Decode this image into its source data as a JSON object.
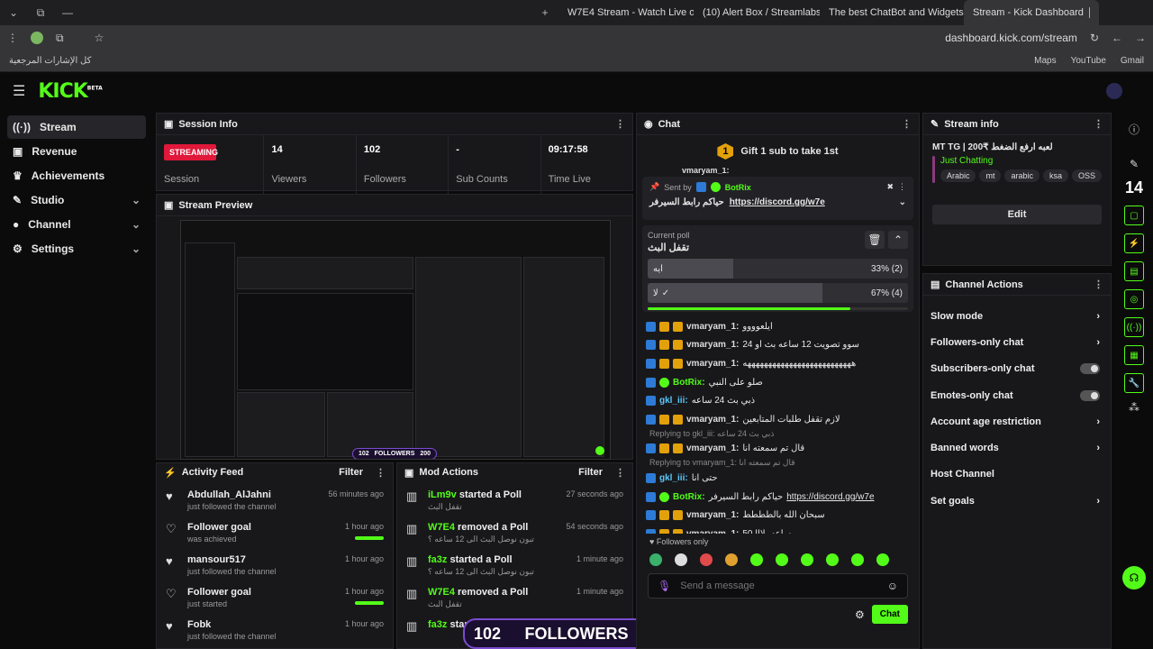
{
  "browser": {
    "tabs": [
      {
        "label": "W7E4 Stream - Watch Live on K"
      },
      {
        "label": "(10) Alert Box / Streamlabs"
      },
      {
        "label": "The best ChatBot and Widgets"
      },
      {
        "label": "Stream - Kick Dashboard"
      }
    ],
    "url": "dashboard.kick.com/stream",
    "bookmarks_folder": "كل الإشارات المرجعية",
    "bookmarks": [
      "Maps",
      "YouTube",
      "Gmail"
    ]
  },
  "brand": {
    "logo": "KICK",
    "beta": "BETA",
    "accent": "#53fc18"
  },
  "sidebar": {
    "items": [
      {
        "label": "Stream",
        "icon": "broadcast-icon"
      },
      {
        "label": "Revenue",
        "icon": "wallet-icon"
      },
      {
        "label": "Achievements",
        "icon": "trophy-icon"
      },
      {
        "label": "Studio",
        "icon": "pen-icon"
      },
      {
        "label": "Channel",
        "icon": "user-icon"
      },
      {
        "label": "Settings",
        "icon": "gear-icon"
      }
    ]
  },
  "session": {
    "title": "Session Info",
    "status": "STREAMING",
    "session_label": "Session",
    "stats": [
      {
        "value": "14",
        "label": "Viewers"
      },
      {
        "value": "102",
        "label": "Followers"
      },
      {
        "value": "-",
        "label": "Sub Counts"
      },
      {
        "value": "09:17:58",
        "label": "Time Live"
      }
    ]
  },
  "preview": {
    "title": "Stream Preview",
    "overlay_count": "102",
    "overlay_label": "FOLLOWERS",
    "overlay_goal": "200"
  },
  "activity": {
    "title": "Activity Feed",
    "filter": "Filter",
    "items": [
      {
        "icon": "heart-icon",
        "name": "Abdullah_AlJahni",
        "desc": "just followed the channel",
        "time": "56 minutes ago",
        "bar": false
      },
      {
        "icon": "heart-outline-icon",
        "name": "Follower goal",
        "desc": "was achieved",
        "time": "1 hour ago",
        "bar": true
      },
      {
        "icon": "heart-icon",
        "name": "mansour517",
        "desc": "just followed the channel",
        "time": "1 hour ago",
        "bar": false
      },
      {
        "icon": "heart-outline-icon",
        "name": "Follower goal",
        "desc": "just started",
        "time": "1 hour ago",
        "bar": true
      },
      {
        "icon": "heart-icon",
        "name": "Fobk",
        "desc": "just followed the channel",
        "time": "1 hour ago",
        "bar": false
      }
    ]
  },
  "mod": {
    "title": "Mod Actions",
    "filter": "Filter",
    "items": [
      {
        "user": "iLm9v",
        "action": "started a Poll",
        "detail": "تقفل البث",
        "time": "27 seconds ago"
      },
      {
        "user": "W7E4",
        "action": "removed a Poll",
        "detail": "تبون نوصل البث الى 12 ساعه ؟",
        "time": "54 seconds ago"
      },
      {
        "user": "fa3z",
        "action": "started a Poll",
        "detail": "تبون نوصل البث الى 12 ساعه ؟",
        "time": "1 minute ago"
      },
      {
        "user": "W7E4",
        "action": "removed a Poll",
        "detail": "تقفل البث",
        "time": "1 minute ago"
      },
      {
        "user": "fa3z",
        "action": "started a Poll",
        "detail": "",
        "time": ""
      }
    ]
  },
  "bottom_overlay": {
    "count": "102",
    "label": "FOLLOWERS",
    "goal": "200"
  },
  "chat": {
    "title": "Chat",
    "gift": "Gift 1 sub to take 1st",
    "gift_count": "1",
    "truncated_top": "vmaryam_1:",
    "pinned": {
      "sent_by": "Sent by",
      "user": "BotRix",
      "text": "حياكم رابط السيرفر",
      "link": "https://discord.gg/w7e"
    },
    "poll": {
      "label": "Current poll",
      "question": "تقفل البث",
      "options": [
        {
          "label": "ايه",
          "result": "33% (2)",
          "pct": 33,
          "voted": false
        },
        {
          "label": "لا",
          "result": "67% (4)",
          "pct": 67,
          "voted": true
        }
      ],
      "timer_fraction": 0.78
    },
    "messages": [
      {
        "user": "vmaryam_1:",
        "text": "ايلعوووو",
        "type": "vm",
        "reply": ""
      },
      {
        "user": "vmaryam_1:",
        "text": "سوو تصويت 12 ساعه بث او 24",
        "type": "vm",
        "reply": ""
      },
      {
        "user": "vmaryam_1:",
        "text": "ههههههههههههههههههههههههههه",
        "type": "vm",
        "reply": ""
      },
      {
        "user": "BotRix:",
        "text": "صلو على النبي",
        "type": "bot",
        "reply": ""
      },
      {
        "user": "gkl_iii:",
        "text": "ذبي بث 24 ساعه",
        "type": "gk",
        "reply": ""
      },
      {
        "user": "vmaryam_1:",
        "text": "لازم تقفل طلبات المتابعين",
        "type": "vm",
        "reply": ""
      },
      {
        "user": "vmaryam_1:",
        "text": "قال تم سمعته انا",
        "type": "vm",
        "reply": "Replying to gkl_iii: ذبي بث 24 ساعه"
      },
      {
        "user": "gkl_iii:",
        "text": "حتى انا",
        "type": "gk",
        "reply": "Replying to vmaryam_1: قال تم سمعته انا"
      },
      {
        "user": "BotRix:",
        "text": "حياكم رابط السيرفر",
        "link": "https://discord.gg/w7e",
        "type": "bot",
        "reply": ""
      },
      {
        "user": "vmaryam_1:",
        "text": "سبحان الله بالطططط",
        "type": "vm",
        "reply": ""
      },
      {
        "user": "vmaryam_1:",
        "text": "50 ساعه يلااا",
        "type": "vm",
        "reply": ""
      }
    ],
    "followers_only": "Followers only",
    "placeholder": "Send a message",
    "send": "Chat"
  },
  "stream_info": {
    "title": "Stream info",
    "stream_title": "MT TG | 200₹ لعبه ارفع الضغط",
    "category": "Just Chatting",
    "tags": [
      "Arabic",
      "mt",
      "arabic",
      "ksa",
      "OSS"
    ],
    "edit": "Edit",
    "viewers": "14"
  },
  "channel_actions": {
    "title": "Channel Actions",
    "items": [
      {
        "label": "Slow mode",
        "control": "chevron"
      },
      {
        "label": "Followers-only chat",
        "control": "chevron"
      },
      {
        "label": "Subscribers-only chat",
        "control": "toggle"
      },
      {
        "label": "Emotes-only chat",
        "control": "toggle"
      },
      {
        "label": "Account age restriction",
        "control": "chevron"
      },
      {
        "label": "Banned words",
        "control": "chevron"
      },
      {
        "label": "Host Channel",
        "control": "none"
      },
      {
        "label": "Set goals",
        "control": "chevron"
      }
    ]
  }
}
